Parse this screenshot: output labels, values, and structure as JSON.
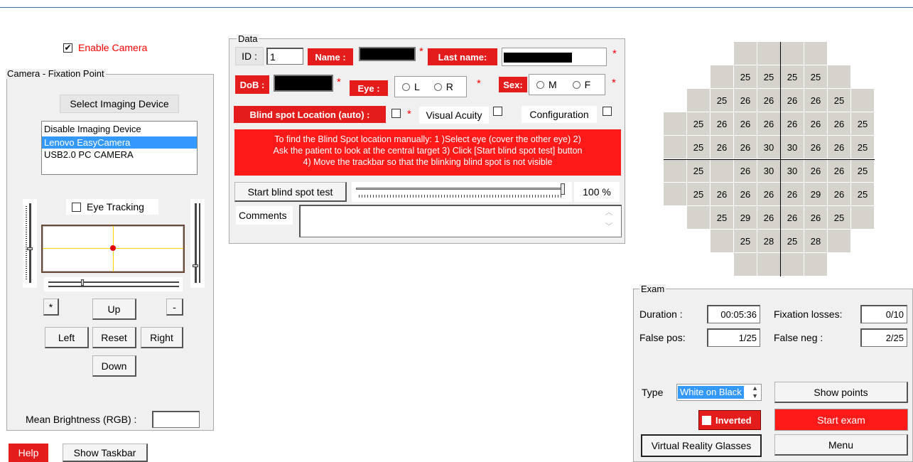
{
  "camera": {
    "enable_label": "Enable Camera",
    "enable_checked": true,
    "group_title": "Camera - Fixation Point",
    "select_device_label": "Select Imaging Device",
    "devices": [
      "Disable Imaging Device",
      "Lenovo EasyCamera",
      "USB2.0 PC CAMERA"
    ],
    "selected_device": "Lenovo EasyCamera",
    "eye_tracking_label": "Eye Tracking",
    "eye_tracking_checked": false,
    "plus_label": "*",
    "minus_label": "-",
    "up_label": "Up",
    "left_label": "Left",
    "reset_label": "Reset",
    "right_label": "Right",
    "down_label": "Down",
    "brightness_label": "Mean Brightness (RGB) :",
    "brightness_value": ""
  },
  "bottom": {
    "help_label": "Help",
    "taskbar_label": "Show Taskbar"
  },
  "data": {
    "group_title": "Data",
    "id_label": "ID :",
    "id_value": "1",
    "name_label": "Name :",
    "lastname_label": "Last name:",
    "dob_label": "DoB :",
    "eye_label": "Eye :",
    "eye_left": "L",
    "eye_right": "R",
    "sex_label": "Sex:",
    "sex_m": "M",
    "sex_f": "F",
    "required_mark": "*",
    "blindspot_label": "Blind spot Location (auto) :",
    "visual_acuity_label": "Visual Acuity",
    "configuration_label": "Configuration",
    "instructions_line1": "To find the Blind Spot location manually: 1 )Select eye (cover the other eye) 2)",
    "instructions_line2": "Ask the patient to look at the central target 3) Click [Start blind spot test] button",
    "instructions_line3": "4) Move the trackbar so that the blinking blind spot is not visible",
    "start_test_label": "Start blind spot test",
    "trackbar_percent": "100 %",
    "trackbar_value": 1.0,
    "comments_label": "Comments",
    "comments_value": ""
  },
  "field_map": {
    "rows": [
      [
        "",
        "",
        "",
        "",
        "",
        "",
        "",
        "",
        ""
      ],
      [
        "",
        "",
        "",
        "25",
        "25",
        "25",
        "25",
        "",
        ""
      ],
      [
        "",
        "",
        "25",
        "26",
        "26",
        "26",
        "26",
        "25",
        ""
      ],
      [
        "",
        "25",
        "26",
        "26",
        "26",
        "26",
        "26",
        "26",
        "25"
      ],
      [
        "",
        "25",
        "26",
        "26",
        "30",
        "30",
        "26",
        "26",
        "25"
      ],
      [
        "",
        "25",
        "",
        "26",
        "30",
        "30",
        "26",
        "26",
        "25"
      ],
      [
        "",
        "25",
        "26",
        "26",
        "26",
        "26",
        "29",
        "26",
        "25"
      ],
      [
        "",
        "",
        "25",
        "29",
        "26",
        "26",
        "26",
        "25",
        ""
      ],
      [
        "",
        "",
        "",
        "25",
        "28",
        "25",
        "28",
        "",
        ""
      ],
      [
        "",
        "",
        "",
        "",
        "",
        "",
        "",
        "",
        ""
      ]
    ]
  },
  "exam": {
    "group_title": "Exam",
    "duration_label": "Duration :",
    "duration_value": "00:05:36",
    "fixation_label": "Fixation losses:",
    "fixation_value": "0/10",
    "falsepos_label": "False pos:",
    "falsepos_value": "1/25",
    "falseneg_label": "False neg :",
    "falseneg_value": "2/25",
    "type_label": "Type",
    "type_value": "White on Black",
    "show_points_label": "Show points",
    "inverted_label": "Inverted",
    "start_exam_label": "Start exam",
    "vr_label": "Virtual Reality Glasses",
    "menu_label": "Menu"
  },
  "colors": {
    "accent_red": "#e51c1c",
    "selection_blue": "#3399ff",
    "grid_cell": "#d6d3cc"
  }
}
